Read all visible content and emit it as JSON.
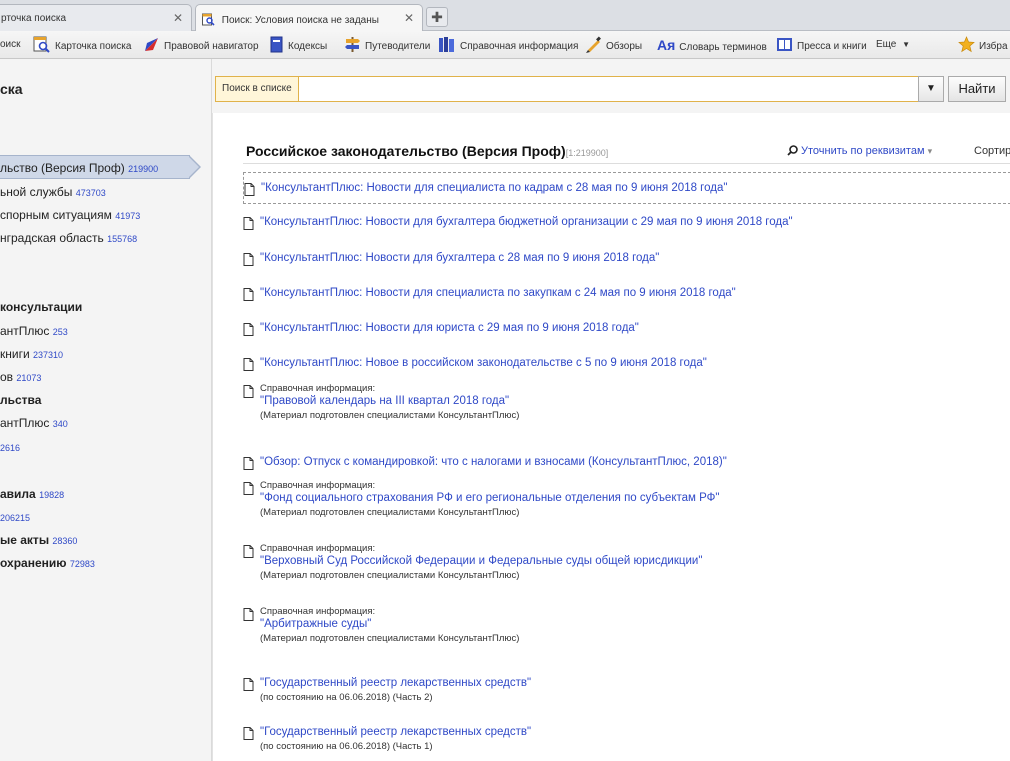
{
  "tabs": [
    {
      "label": "рточка поиска",
      "close": "✕"
    },
    {
      "label": "Поиск: Условия поиска не заданы",
      "close": "✕"
    }
  ],
  "new_tab": "✚",
  "toolbar": {
    "items": [
      "оиск",
      "Карточка поиска",
      "Правовой навигатор",
      "Кодексы",
      "Путеводители",
      "Справочная информация",
      "Обзоры",
      "Словарь терминов",
      "Пресса и книги",
      "Еще",
      "Избра"
    ],
    "dict_glyph": "Ая",
    "more_arrow": "▼"
  },
  "sidebar": {
    "title": "ска",
    "items": [
      {
        "label": "льство (Версия Проф)",
        "count": "219900",
        "bold": false
      },
      {
        "label": "ьной службы",
        "count": "473703",
        "bold": false
      },
      {
        "label": "спорным ситуациям",
        "count": "41973",
        "bold": false
      },
      {
        "label": "нградская область",
        "count": "155768",
        "bold": false
      },
      {
        "label": "консультации",
        "count": "",
        "bold": true
      },
      {
        "label": "антПлюс",
        "count": "253",
        "bold": false
      },
      {
        "label": "книги",
        "count": "237310",
        "bold": false
      },
      {
        "label": "ов",
        "count": "21073",
        "bold": false
      },
      {
        "label": "льства",
        "count": "",
        "bold": true
      },
      {
        "label": "антПлюс",
        "count": "340",
        "bold": false
      },
      {
        "label": "",
        "count": "2616",
        "bold": false
      },
      {
        "label": "авила",
        "count": "19828",
        "bold": true
      },
      {
        "label": "",
        "count": "206215",
        "bold": false
      },
      {
        "label": "ые акты",
        "count": "28360",
        "bold": true
      },
      {
        "label": "охранению",
        "count": "72983",
        "bold": true
      }
    ]
  },
  "search": {
    "label": "Поиск в списке",
    "value": "",
    "dropdown": "▼",
    "button": "Найти"
  },
  "content": {
    "header_title": "Российское законодательство (Версия Проф)",
    "header_range": "[1:219900]",
    "refine": "Уточнить по реквизитам",
    "refine_arrow": "▾",
    "sort": "Сортир",
    "docs": [
      {
        "prefix": "",
        "title": "\"КонсультантПлюс: Новости для специалиста по кадрам с 28 мая по 9 июня 2018 года\"",
        "note": ""
      },
      {
        "prefix": "",
        "title": "\"КонсультантПлюс: Новости для бухгалтера бюджетной организации с 29 мая по 9 июня 2018 года\"",
        "note": ""
      },
      {
        "prefix": "",
        "title": "\"КонсультантПлюс: Новости для бухгалтера с 28 мая по 9 июня 2018 года\"",
        "note": ""
      },
      {
        "prefix": "",
        "title": "\"КонсультантПлюс: Новости для специалиста по закупкам с 24 мая по 9 июня 2018 года\"",
        "note": ""
      },
      {
        "prefix": "",
        "title": "\"КонсультантПлюс: Новости для юриста с 29 мая по 9 июня 2018 года\"",
        "note": ""
      },
      {
        "prefix": "",
        "title": "\"КонсультантПлюс: Новое в российском законодательстве с 5 по 9 июня 2018 года\"",
        "note": ""
      },
      {
        "prefix": "Справочная информация:",
        "title": "\"Правовой календарь на III квартал 2018 года\"",
        "note": "(Материал подготовлен специалистами КонсультантПлюс)"
      },
      {
        "prefix": "",
        "title": "\"Обзор: Отпуск с командировкой: что с налогами и взносами (КонсультантПлюс, 2018)\"",
        "note": ""
      },
      {
        "prefix": "Справочная информация:",
        "title": "\"Фонд социального страхования РФ и его региональные отделения по субъектам РФ\"",
        "note": "(Материал подготовлен специалистами КонсультантПлюс)"
      },
      {
        "prefix": "Справочная информация:",
        "title": "\"Верховный Суд Российской Федерации и Федеральные суды общей юрисдикции\"",
        "note": "(Материал подготовлен специалистами КонсультантПлюс)"
      },
      {
        "prefix": "Справочная информация:",
        "title": "\"Арбитражные суды\"",
        "note": "(Материал подготовлен специалистами КонсультантПлюс)"
      },
      {
        "prefix": "",
        "title": "\"Государственный реестр лекарственных средств\"",
        "note": "(по состоянию на 06.06.2018) (Часть 2)"
      },
      {
        "prefix": "",
        "title": "\"Государственный реестр лекарственных средств\"",
        "note": "(по состоянию на 06.06.2018) (Часть 1)"
      }
    ]
  },
  "colors": {
    "accent": "#2f49c7",
    "search_border": "#e0b24a",
    "selected": "#cfd8e8"
  }
}
